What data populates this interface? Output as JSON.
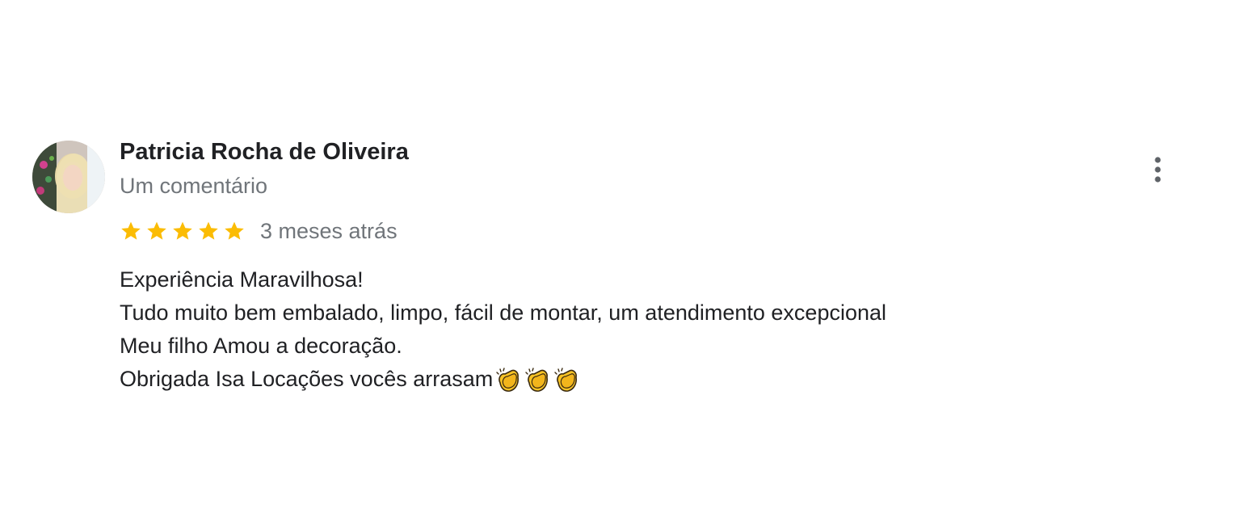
{
  "review": {
    "author_name": "Patricia Rocha de Oliveira",
    "review_count": "Um comentário",
    "rating": 5,
    "rating_max": 5,
    "time_ago": "3 meses atrás",
    "lines": [
      "Experiência Maravilhosa!",
      "Tudo muito bem embalado, limpo, fácil de montar, um atendimento excepcional",
      "Meu filho Amou a decoração.",
      "Obrigada Isa Locações vocês arrasam"
    ],
    "emoji": [
      "clapping-hands-emoji",
      "clapping-hands-emoji",
      "clapping-hands-emoji"
    ],
    "star_color": "#fbbc04",
    "more_icon": "vertical-dots-icon"
  }
}
